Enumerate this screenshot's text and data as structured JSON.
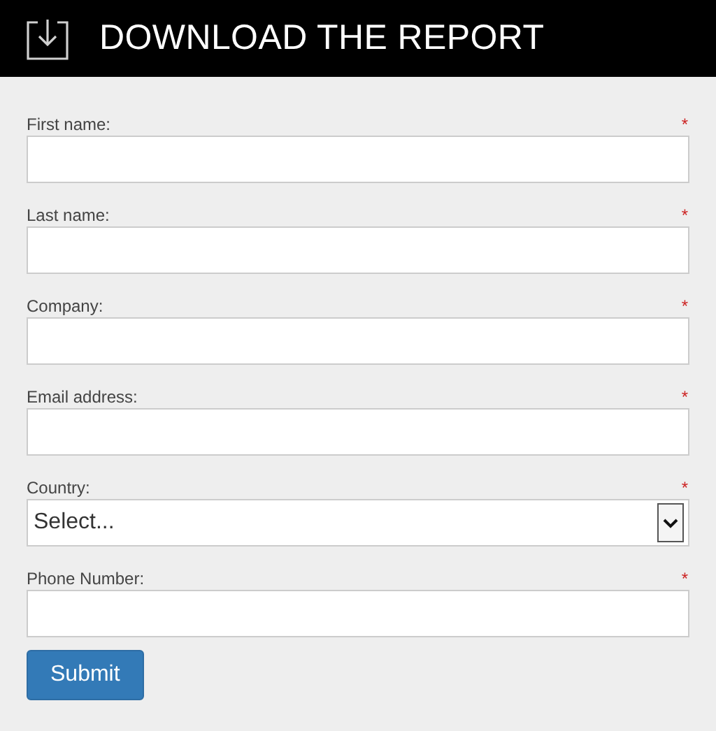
{
  "header": {
    "title": "DOWNLOAD THE REPORT"
  },
  "fields": [
    {
      "kind": "text",
      "label": "First name:",
      "required_mark": "*"
    },
    {
      "kind": "text",
      "label": "Last name:",
      "required_mark": "*"
    },
    {
      "kind": "text",
      "label": "Company:",
      "required_mark": "*"
    },
    {
      "kind": "text",
      "label": "Email address:",
      "required_mark": "*"
    },
    {
      "kind": "select",
      "label": "Country:",
      "required_mark": "*",
      "value": "Select..."
    },
    {
      "kind": "text",
      "label": "Phone Number:",
      "required_mark": "*"
    }
  ],
  "submit": "Submit"
}
